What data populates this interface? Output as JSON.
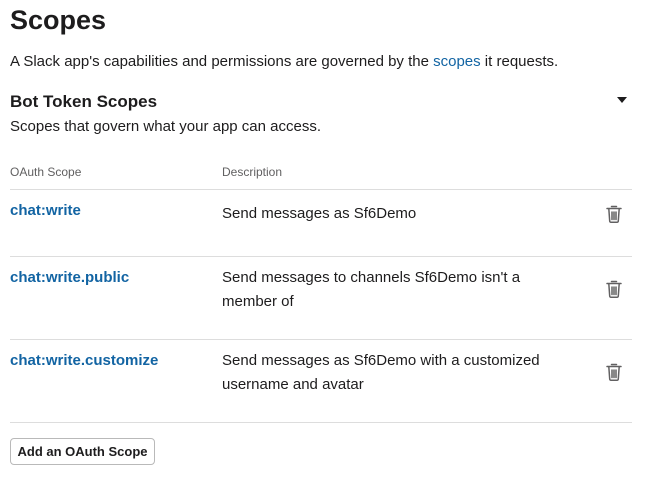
{
  "page": {
    "title": "Scopes",
    "intro_prefix": "A Slack app's capabilities and permissions are governed by the ",
    "intro_link": "scopes",
    "intro_suffix": " it requests."
  },
  "bot_token_scopes": {
    "title": "Bot Token Scopes",
    "subtitle": "Scopes that govern what your app can access.",
    "collapse_icon": "caret-down-icon",
    "columns": {
      "scope": "OAuth Scope",
      "description": "Description"
    },
    "rows": [
      {
        "scope": "chat:write",
        "description": "Send messages as Sf6Demo",
        "delete_icon": "trash-icon"
      },
      {
        "scope": "chat:write.public",
        "description": "Send messages to channels Sf6Demo isn't a member of",
        "delete_icon": "trash-icon"
      },
      {
        "scope": "chat:write.customize",
        "description": "Send messages as Sf6Demo with a customized username and avatar",
        "delete_icon": "trash-icon"
      }
    ],
    "add_button_label": "Add an OAuth Scope"
  },
  "colors": {
    "link": "#1264a3",
    "text": "#1d1c1d",
    "muted": "#616061",
    "divider": "#dddddd"
  }
}
